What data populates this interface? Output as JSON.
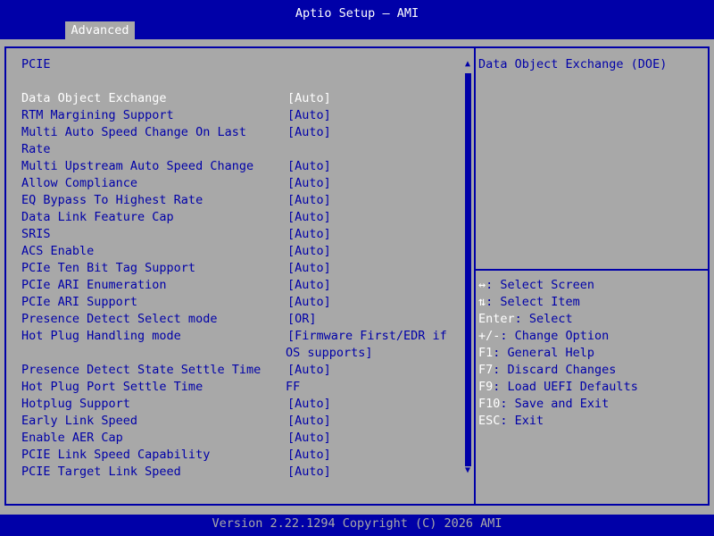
{
  "header": {
    "title": "Aptio Setup – AMI",
    "tab": "Advanced"
  },
  "section_title": "PCIE",
  "settings": [
    {
      "label": "Data Object Exchange",
      "value": "[Auto]"
    },
    {
      "label": "RTM Margining Support",
      "value": "[Auto]"
    },
    {
      "label": "Multi Auto Speed Change On Last",
      "label2": "Rate",
      "value": "[Auto]"
    },
    {
      "label": "Multi Upstream Auto Speed Change",
      "value": "[Auto]"
    },
    {
      "label": "Allow Compliance",
      "value": "[Auto]"
    },
    {
      "label": "EQ Bypass To Highest Rate",
      "value": "[Auto]"
    },
    {
      "label": "Data Link Feature Cap",
      "value": "[Auto]"
    },
    {
      "label": "SRIS",
      "value": "[Auto]"
    },
    {
      "label": "ACS Enable",
      "value": "[Auto]"
    },
    {
      "label": "PCIe Ten Bit Tag Support",
      "value": "[Auto]"
    },
    {
      "label": "PCIe ARI Enumeration",
      "value": "[Auto]"
    },
    {
      "label": "PCIe ARI Support",
      "value": "[Auto]"
    },
    {
      "label": "Presence Detect Select mode",
      "value": "[OR]"
    },
    {
      "label": "Hot Plug Handling mode",
      "value": "[Firmware First/EDR if",
      "value2": "OS supports]"
    },
    {
      "label": "Presence Detect State Settle Time",
      "value": "[Auto]"
    },
    {
      "label": "Hot Plug Port Settle Time",
      "value": "FF"
    },
    {
      "label": "Hotplug Support",
      "value": "[Auto]"
    },
    {
      "label": "Early Link Speed",
      "value": "[Auto]"
    },
    {
      "label": "Enable AER Cap",
      "value": "[Auto]"
    },
    {
      "label": "PCIE Link Speed Capability",
      "value": "[Auto]"
    },
    {
      "label": "PCIE Target Link Speed",
      "value": "[Auto]"
    }
  ],
  "help": {
    "text": "Data Object Exchange (DOE)"
  },
  "keys": [
    {
      "key": "↔",
      "desc": ": Select Screen"
    },
    {
      "key": "⇅",
      "desc": ": Select Item"
    },
    {
      "key": "Enter",
      "desc": ": Select"
    },
    {
      "key": "+/-",
      "desc": ": Change Option"
    },
    {
      "key": "F1",
      "desc": ": General Help"
    },
    {
      "key": "F7",
      "desc": ": Discard Changes"
    },
    {
      "key": "F9",
      "desc": ": Load UEFI Defaults"
    },
    {
      "key": "F10",
      "desc": ": Save and Exit"
    },
    {
      "key": "ESC",
      "desc": ": Exit"
    }
  ],
  "footer": "Version 2.22.1294 Copyright (C) 2026 AMI",
  "scrollbar": {
    "thumb_fraction": 0.78
  },
  "colors": {
    "background": "#0000a8",
    "panel": "#a8a8a8",
    "selected_text": "#ffffff",
    "text": "#0000a8"
  }
}
